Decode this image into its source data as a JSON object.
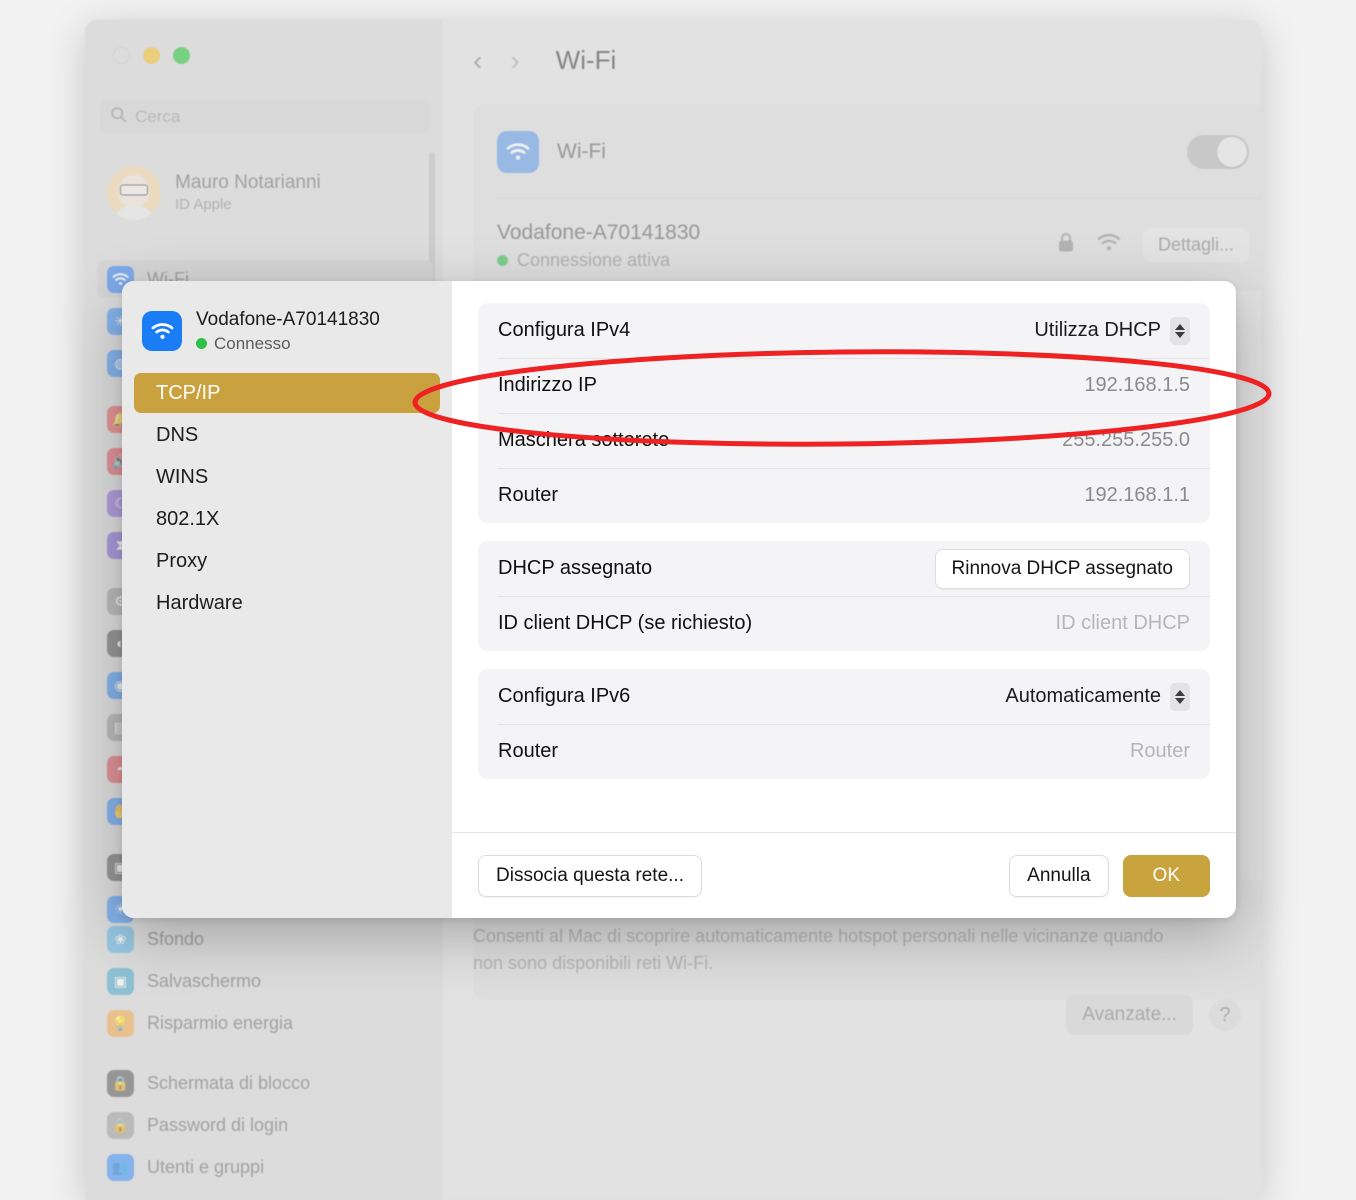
{
  "window": {
    "traffic_lights": [
      "close",
      "minimize",
      "zoom"
    ],
    "search": {
      "placeholder": "Cerca",
      "icon": "search-icon"
    },
    "account": {
      "name": "Mauro Notarianni",
      "subtitle": "ID Apple"
    }
  },
  "sidebar": {
    "selected": "Wi-Fi",
    "items": [
      {
        "label": "Wi-Fi",
        "icon": "wifi-icon",
        "color": "#2f7ff0",
        "selected": true
      },
      {
        "label": "",
        "icon": "bluetooth-icon",
        "color": "#3b8ef5",
        "selected": false
      },
      {
        "label": "",
        "icon": "network-icon",
        "color": "#3b8ef5",
        "selected": false
      },
      {
        "label": "",
        "icon": "notifications-icon",
        "color": "#e8565a",
        "selected": false
      },
      {
        "label": "",
        "icon": "sound-icon",
        "color": "#e0525b",
        "selected": false
      },
      {
        "label": "",
        "icon": "focus-icon",
        "color": "#8a63d8",
        "selected": false
      },
      {
        "label": "",
        "icon": "screen-time-icon",
        "color": "#7b5fd4",
        "selected": false
      },
      {
        "label": "",
        "icon": "general-icon",
        "color": "#9b9b9b",
        "selected": false
      },
      {
        "label": "",
        "icon": "appearance-icon",
        "color": "#5a5a5a",
        "selected": false
      },
      {
        "label": "",
        "icon": "accessibility-icon",
        "color": "#3b8ef5",
        "selected": false
      },
      {
        "label": "",
        "icon": "control-center-icon",
        "color": "#9b9b9b",
        "selected": false
      },
      {
        "label": "",
        "icon": "siri-icon",
        "color": "#e0525b",
        "selected": false
      },
      {
        "label": "",
        "icon": "privacy-icon",
        "color": "#3b8ef5",
        "selected": false
      },
      {
        "label": "",
        "icon": "desktop-dock-icon",
        "color": "#5a5a5a",
        "selected": false
      },
      {
        "label": "",
        "icon": "displays-icon",
        "color": "#3b8ef5",
        "selected": false
      }
    ],
    "bottom_items": [
      {
        "label": "Sfondo",
        "icon": "wallpaper-icon",
        "color": "#5ab4e6"
      },
      {
        "label": "Salvaschermo",
        "icon": "screensaver-icon",
        "color": "#4aa8c9"
      },
      {
        "label": "Risparmio energia",
        "icon": "energy-saver-icon",
        "color": "#f0a64b"
      },
      {
        "label": "Schermata di blocco",
        "icon": "lock-screen-icon",
        "color": "#5a5a5a"
      },
      {
        "label": "Password di login",
        "icon": "login-password-icon",
        "color": "#9b9b9b"
      },
      {
        "label": "Utenti e gruppi",
        "icon": "users-groups-icon",
        "color": "#3b8ef5"
      }
    ]
  },
  "content": {
    "nav": {
      "back_icon": "chevron-left-icon",
      "forward_icon": "chevron-right-icon",
      "title": "Wi-Fi"
    },
    "wifi_toggle_row": {
      "label": "Wi-Fi",
      "icon": "wifi-icon",
      "toggle_state": "off"
    },
    "network": {
      "name": "Vodafone-A70141830",
      "status": "Connessione attiva",
      "status_color": "#2fc04a",
      "lock_icon": "lock-icon",
      "signal_icon": "wifi-signal-icon",
      "details_button": "Dettagli..."
    },
    "helper_text": "Consenti al Mac di scoprire automaticamente hotspot personali nelle vicinanze quando non sono disponibili reti Wi-Fi.",
    "advanced_button": "Avanzate...",
    "help_button": "?"
  },
  "sheet": {
    "network": {
      "name": "Vodafone-A70141830",
      "status": "Connesso",
      "status_color": "#2fc04a",
      "icon": "wifi-icon"
    },
    "menu": {
      "selected": "TCP/IP",
      "items": [
        "TCP/IP",
        "DNS",
        "WINS",
        "802.1X",
        "Proxy",
        "Hardware"
      ]
    },
    "ipv4_group": [
      {
        "key": "Configura IPv4",
        "value": "Utilizza DHCP",
        "control": "popup"
      },
      {
        "key": "Indirizzo IP",
        "value": "192.168.1.5",
        "control": "text"
      },
      {
        "key": "Maschera sottorete",
        "value": "255.255.255.0",
        "control": "text"
      },
      {
        "key": "Router",
        "value": "192.168.1.1",
        "control": "text"
      }
    ],
    "dhcp_group": [
      {
        "key": "DHCP assegnato",
        "value": "Rinnova DHCP assegnato",
        "control": "button"
      },
      {
        "key": "ID client DHCP (se richiesto)",
        "value": "ID client DHCP",
        "control": "placeholder"
      }
    ],
    "ipv6_group": [
      {
        "key": "Configura IPv6",
        "value": "Automaticamente",
        "control": "popup"
      },
      {
        "key": "Router",
        "value": "Router",
        "control": "placeholder"
      }
    ],
    "footer": {
      "forget_button": "Dissocia questa rete...",
      "cancel_button": "Annulla",
      "ok_button": "OK"
    },
    "accent_color": "#c9a33e"
  },
  "annotation": {
    "shape": "ellipse",
    "color": "#ee2222",
    "targets": "Indirizzo IP 192.168.1.5"
  }
}
